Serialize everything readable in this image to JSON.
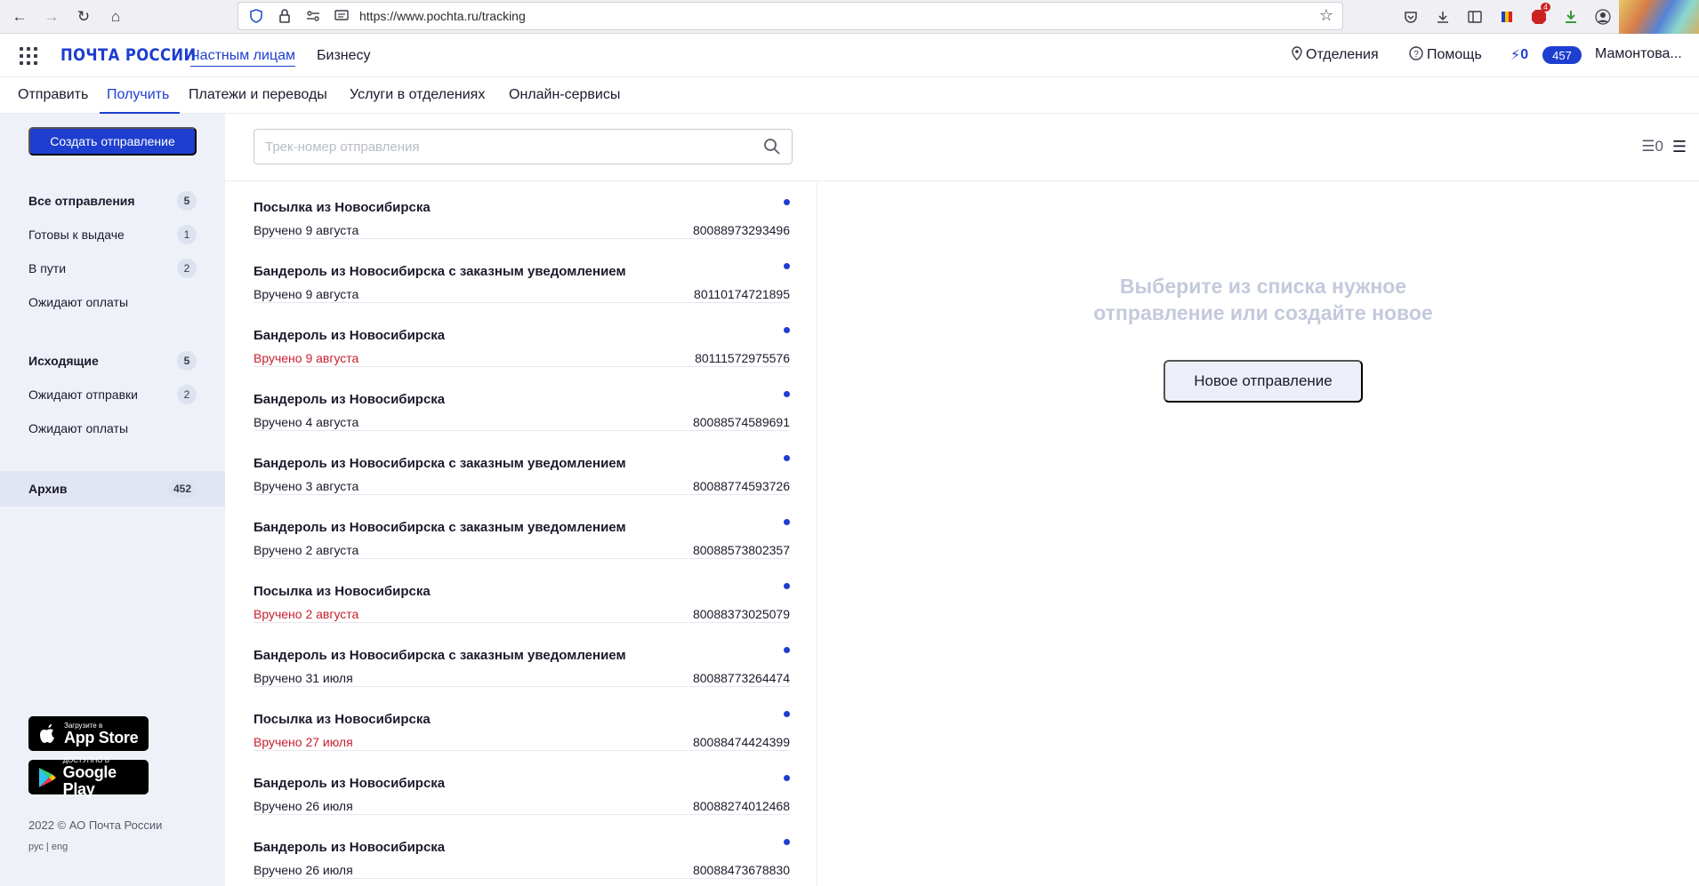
{
  "browser": {
    "url": "https://www.pochta.ru/tracking",
    "ext_badge": "4"
  },
  "header": {
    "logo": "ПОЧТА РОССИИ",
    "nav_private": "Частным лицам",
    "nav_business": "Бизнесу",
    "offices": "Отделения",
    "help": "Помощь",
    "bolt_count": "0",
    "notifications": "457",
    "user": "Мамонтова..."
  },
  "subnav": {
    "items": [
      "Отправить",
      "Получить",
      "Платежи и переводы",
      "Услуги в отделениях",
      "Онлайн-сервисы"
    ],
    "active": "Получить"
  },
  "sidebar": {
    "create_button": "Создать отправление",
    "groups": [
      {
        "title": "Все отправления",
        "count": "5",
        "items": [
          {
            "label": "Готовы к выдаче",
            "count": "1"
          },
          {
            "label": "В пути",
            "count": "2"
          },
          {
            "label": "Ожидают оплаты",
            "count": ""
          }
        ]
      },
      {
        "title": "Исходящие",
        "count": "5",
        "items": [
          {
            "label": "Ожидают отправки",
            "count": "2"
          },
          {
            "label": "Ожидают оплаты",
            "count": ""
          }
        ]
      }
    ],
    "archive": {
      "label": "Архив",
      "count": "452"
    },
    "appstore_small": "Загрузите в",
    "appstore_big": "App Store",
    "googleplay_small": "ДОСТУПНО В",
    "googleplay_big": "Google Play",
    "copyright": "2022 © АО Почта России",
    "lang": "рус | eng"
  },
  "search": {
    "placeholder": "Трек-номер отправления",
    "view_toggle": "☰0"
  },
  "shipments": [
    {
      "title": "Посылка из Новосибирска",
      "status": "Вручено 9 августа",
      "track": "80088973293496",
      "red": false
    },
    {
      "title": "Бандероль из Новосибирска с заказным уведомлением",
      "status": "Вручено 9 августа",
      "track": "80110174721895",
      "red": false
    },
    {
      "title": "Бандероль из Новосибирска",
      "status": "Вручено 9 августа",
      "track": "80111572975576",
      "red": true
    },
    {
      "title": "Бандероль из Новосибирска",
      "status": "Вручено 4 августа",
      "track": "80088574589691",
      "red": false
    },
    {
      "title": "Бандероль из Новосибирска с заказным уведомлением",
      "status": "Вручено 3 августа",
      "track": "80088774593726",
      "red": false
    },
    {
      "title": "Бандероль из Новосибирска с заказным уведомлением",
      "status": "Вручено 2 августа",
      "track": "80088573802357",
      "red": false
    },
    {
      "title": "Посылка из Новосибирска",
      "status": "Вручено 2 августа",
      "track": "80088373025079",
      "red": true
    },
    {
      "title": "Бандероль из Новосибирска с заказным уведомлением",
      "status": "Вручено 31 июля",
      "track": "80088773264474",
      "red": false
    },
    {
      "title": "Посылка из Новосибирска",
      "status": "Вручено 27 июля",
      "track": "80088474424399",
      "red": true
    },
    {
      "title": "Бандероль из Новосибирска",
      "status": "Вручено 26 июля",
      "track": "80088274012468",
      "red": false
    },
    {
      "title": "Бандероль из Новосибирска",
      "status": "Вручено 26 июля",
      "track": "80088473678830",
      "red": false
    }
  ],
  "detail": {
    "empty_line1": "Выберите из списка нужное",
    "empty_line2": "отправление или создайте новое",
    "new_button": "Новое отправление"
  },
  "colors": {
    "accent": "#1d3ecf",
    "status_red": "#c81e2e",
    "sidebar_bg": "#eef1f8"
  }
}
